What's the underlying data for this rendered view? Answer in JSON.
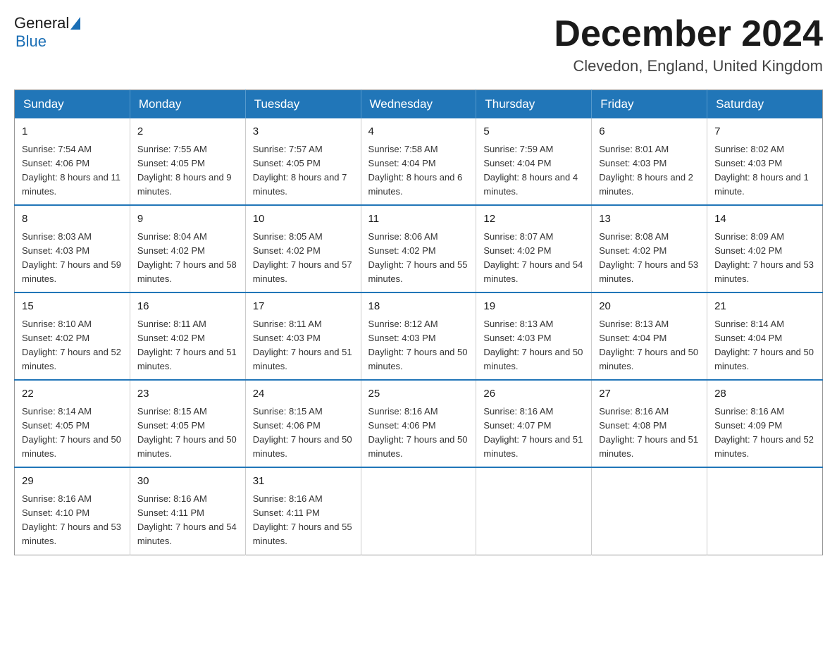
{
  "header": {
    "logo_general": "General",
    "logo_blue": "Blue",
    "month_title": "December 2024",
    "location": "Clevedon, England, United Kingdom"
  },
  "days_of_week": [
    "Sunday",
    "Monday",
    "Tuesday",
    "Wednesday",
    "Thursday",
    "Friday",
    "Saturday"
  ],
  "weeks": [
    [
      {
        "day": "1",
        "sunrise": "Sunrise: 7:54 AM",
        "sunset": "Sunset: 4:06 PM",
        "daylight": "Daylight: 8 hours and 11 minutes."
      },
      {
        "day": "2",
        "sunrise": "Sunrise: 7:55 AM",
        "sunset": "Sunset: 4:05 PM",
        "daylight": "Daylight: 8 hours and 9 minutes."
      },
      {
        "day": "3",
        "sunrise": "Sunrise: 7:57 AM",
        "sunset": "Sunset: 4:05 PM",
        "daylight": "Daylight: 8 hours and 7 minutes."
      },
      {
        "day": "4",
        "sunrise": "Sunrise: 7:58 AM",
        "sunset": "Sunset: 4:04 PM",
        "daylight": "Daylight: 8 hours and 6 minutes."
      },
      {
        "day": "5",
        "sunrise": "Sunrise: 7:59 AM",
        "sunset": "Sunset: 4:04 PM",
        "daylight": "Daylight: 8 hours and 4 minutes."
      },
      {
        "day": "6",
        "sunrise": "Sunrise: 8:01 AM",
        "sunset": "Sunset: 4:03 PM",
        "daylight": "Daylight: 8 hours and 2 minutes."
      },
      {
        "day": "7",
        "sunrise": "Sunrise: 8:02 AM",
        "sunset": "Sunset: 4:03 PM",
        "daylight": "Daylight: 8 hours and 1 minute."
      }
    ],
    [
      {
        "day": "8",
        "sunrise": "Sunrise: 8:03 AM",
        "sunset": "Sunset: 4:03 PM",
        "daylight": "Daylight: 7 hours and 59 minutes."
      },
      {
        "day": "9",
        "sunrise": "Sunrise: 8:04 AM",
        "sunset": "Sunset: 4:02 PM",
        "daylight": "Daylight: 7 hours and 58 minutes."
      },
      {
        "day": "10",
        "sunrise": "Sunrise: 8:05 AM",
        "sunset": "Sunset: 4:02 PM",
        "daylight": "Daylight: 7 hours and 57 minutes."
      },
      {
        "day": "11",
        "sunrise": "Sunrise: 8:06 AM",
        "sunset": "Sunset: 4:02 PM",
        "daylight": "Daylight: 7 hours and 55 minutes."
      },
      {
        "day": "12",
        "sunrise": "Sunrise: 8:07 AM",
        "sunset": "Sunset: 4:02 PM",
        "daylight": "Daylight: 7 hours and 54 minutes."
      },
      {
        "day": "13",
        "sunrise": "Sunrise: 8:08 AM",
        "sunset": "Sunset: 4:02 PM",
        "daylight": "Daylight: 7 hours and 53 minutes."
      },
      {
        "day": "14",
        "sunrise": "Sunrise: 8:09 AM",
        "sunset": "Sunset: 4:02 PM",
        "daylight": "Daylight: 7 hours and 53 minutes."
      }
    ],
    [
      {
        "day": "15",
        "sunrise": "Sunrise: 8:10 AM",
        "sunset": "Sunset: 4:02 PM",
        "daylight": "Daylight: 7 hours and 52 minutes."
      },
      {
        "day": "16",
        "sunrise": "Sunrise: 8:11 AM",
        "sunset": "Sunset: 4:02 PM",
        "daylight": "Daylight: 7 hours and 51 minutes."
      },
      {
        "day": "17",
        "sunrise": "Sunrise: 8:11 AM",
        "sunset": "Sunset: 4:03 PM",
        "daylight": "Daylight: 7 hours and 51 minutes."
      },
      {
        "day": "18",
        "sunrise": "Sunrise: 8:12 AM",
        "sunset": "Sunset: 4:03 PM",
        "daylight": "Daylight: 7 hours and 50 minutes."
      },
      {
        "day": "19",
        "sunrise": "Sunrise: 8:13 AM",
        "sunset": "Sunset: 4:03 PM",
        "daylight": "Daylight: 7 hours and 50 minutes."
      },
      {
        "day": "20",
        "sunrise": "Sunrise: 8:13 AM",
        "sunset": "Sunset: 4:04 PM",
        "daylight": "Daylight: 7 hours and 50 minutes."
      },
      {
        "day": "21",
        "sunrise": "Sunrise: 8:14 AM",
        "sunset": "Sunset: 4:04 PM",
        "daylight": "Daylight: 7 hours and 50 minutes."
      }
    ],
    [
      {
        "day": "22",
        "sunrise": "Sunrise: 8:14 AM",
        "sunset": "Sunset: 4:05 PM",
        "daylight": "Daylight: 7 hours and 50 minutes."
      },
      {
        "day": "23",
        "sunrise": "Sunrise: 8:15 AM",
        "sunset": "Sunset: 4:05 PM",
        "daylight": "Daylight: 7 hours and 50 minutes."
      },
      {
        "day": "24",
        "sunrise": "Sunrise: 8:15 AM",
        "sunset": "Sunset: 4:06 PM",
        "daylight": "Daylight: 7 hours and 50 minutes."
      },
      {
        "day": "25",
        "sunrise": "Sunrise: 8:16 AM",
        "sunset": "Sunset: 4:06 PM",
        "daylight": "Daylight: 7 hours and 50 minutes."
      },
      {
        "day": "26",
        "sunrise": "Sunrise: 8:16 AM",
        "sunset": "Sunset: 4:07 PM",
        "daylight": "Daylight: 7 hours and 51 minutes."
      },
      {
        "day": "27",
        "sunrise": "Sunrise: 8:16 AM",
        "sunset": "Sunset: 4:08 PM",
        "daylight": "Daylight: 7 hours and 51 minutes."
      },
      {
        "day": "28",
        "sunrise": "Sunrise: 8:16 AM",
        "sunset": "Sunset: 4:09 PM",
        "daylight": "Daylight: 7 hours and 52 minutes."
      }
    ],
    [
      {
        "day": "29",
        "sunrise": "Sunrise: 8:16 AM",
        "sunset": "Sunset: 4:10 PM",
        "daylight": "Daylight: 7 hours and 53 minutes."
      },
      {
        "day": "30",
        "sunrise": "Sunrise: 8:16 AM",
        "sunset": "Sunset: 4:11 PM",
        "daylight": "Daylight: 7 hours and 54 minutes."
      },
      {
        "day": "31",
        "sunrise": "Sunrise: 8:16 AM",
        "sunset": "Sunset: 4:11 PM",
        "daylight": "Daylight: 7 hours and 55 minutes."
      },
      null,
      null,
      null,
      null
    ]
  ]
}
